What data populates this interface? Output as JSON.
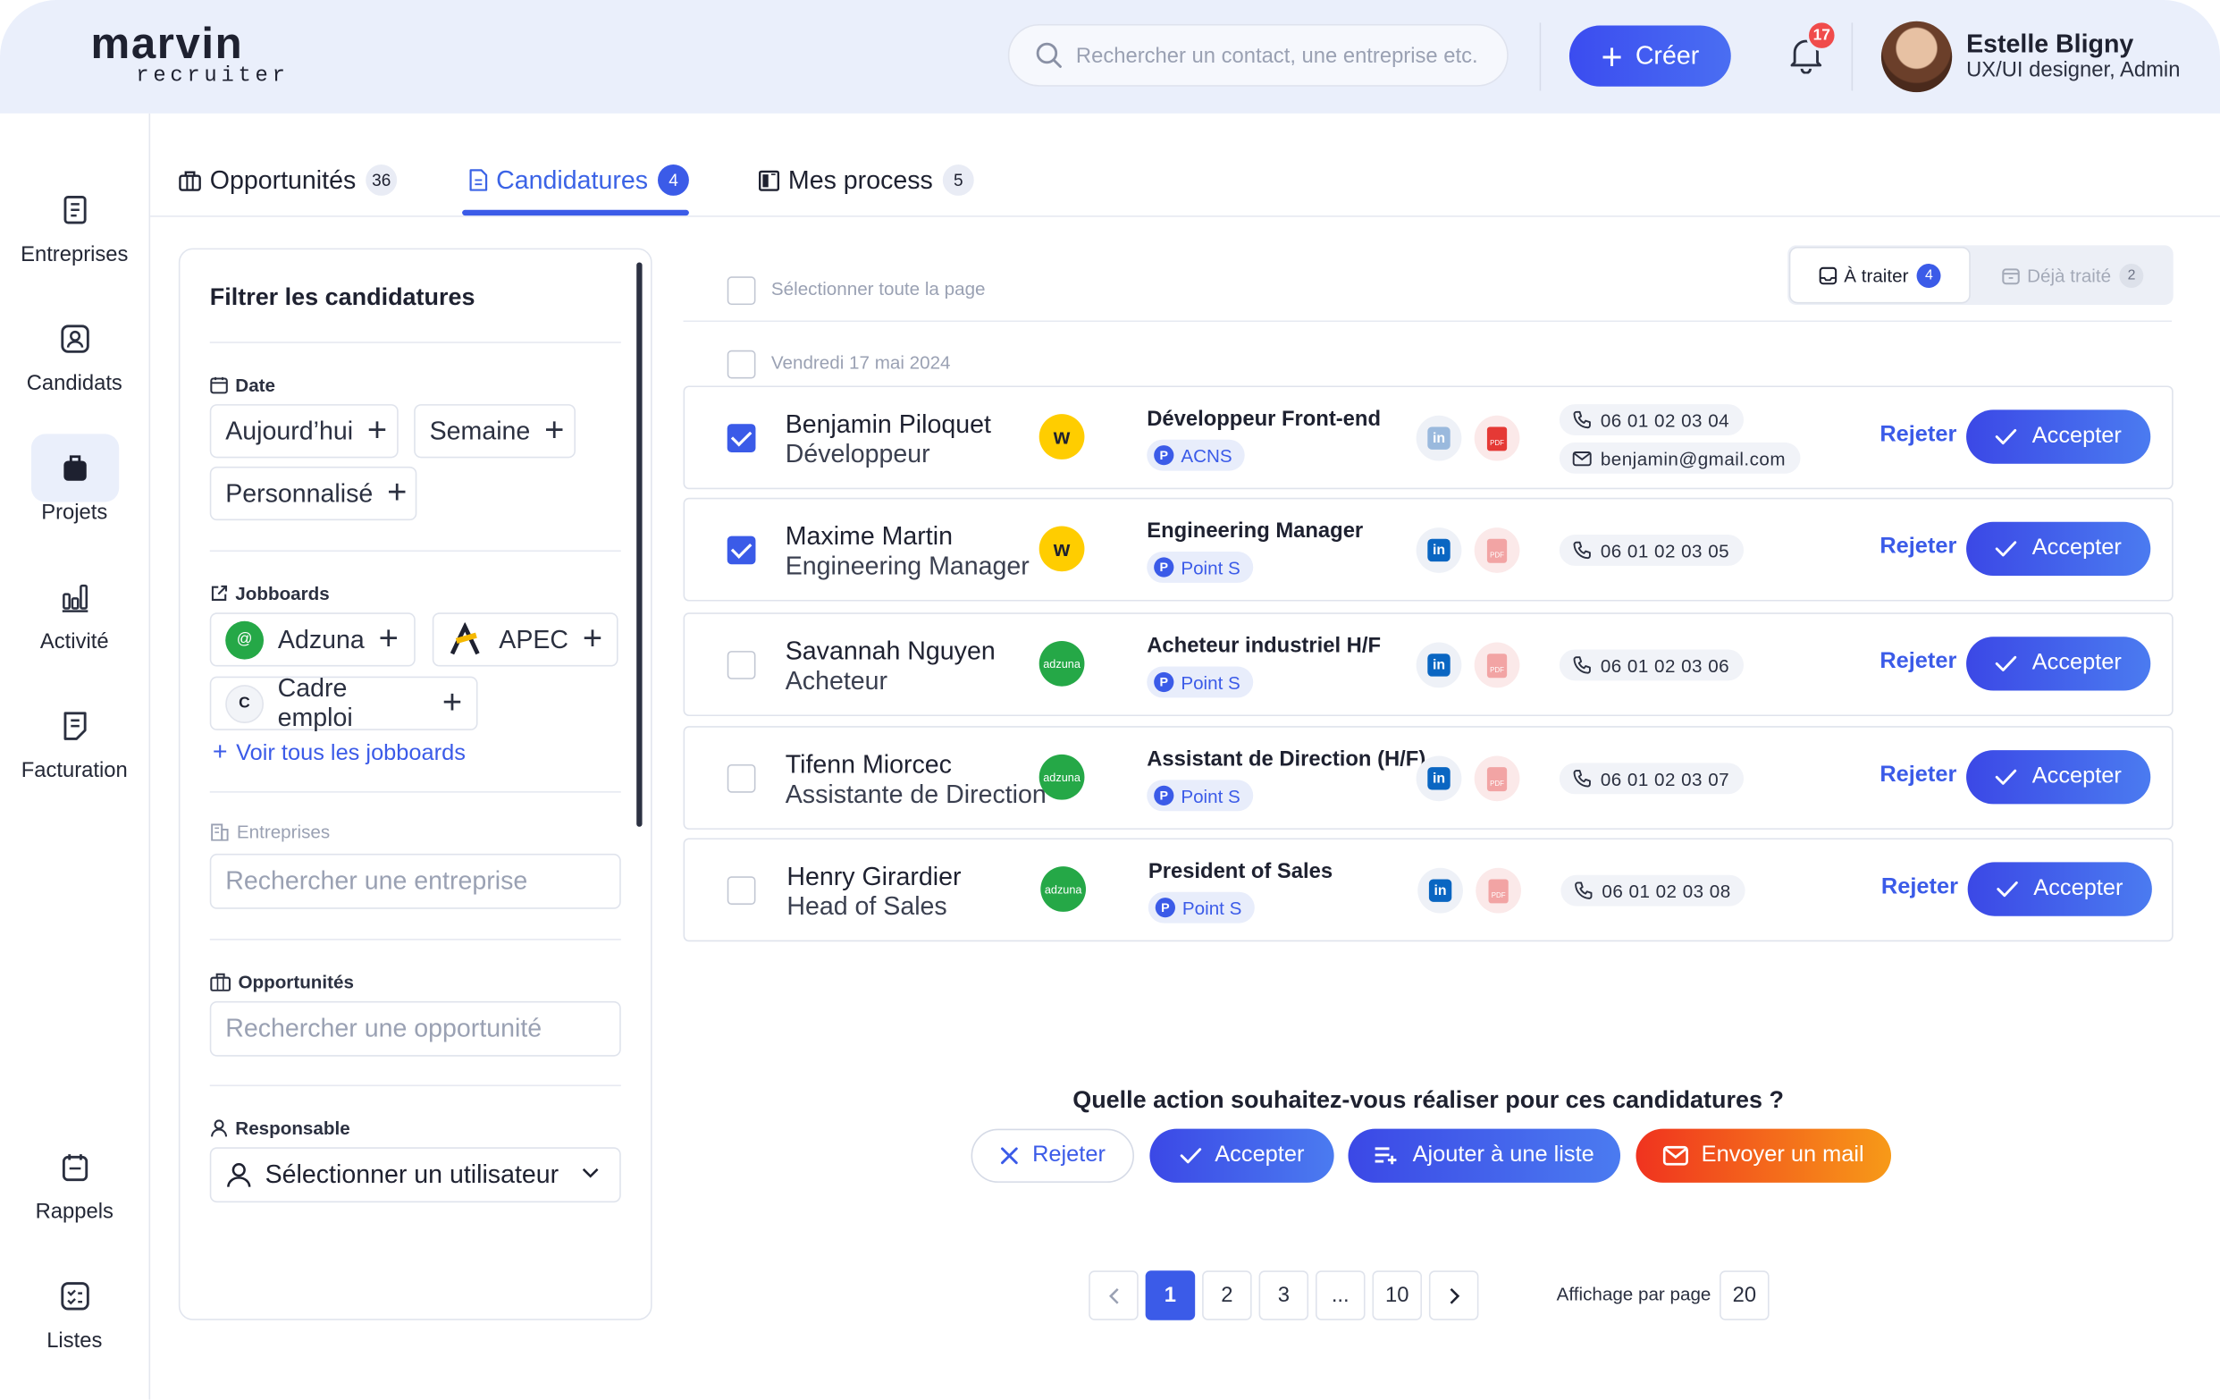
{
  "app": {
    "logo_main": "marvin",
    "logo_sub": "recruiter"
  },
  "header": {
    "search_placeholder": "Rechercher un contact, une entreprise etc.",
    "create_label": "Créer",
    "notifications_count": "17",
    "user_name": "Estelle Bligny",
    "user_role": "UX/UI designer, Admin"
  },
  "sidebar": {
    "items": [
      {
        "label": "Entreprises",
        "icon": "building-icon"
      },
      {
        "label": "Candidats",
        "icon": "user-badge-icon"
      },
      {
        "label": "Projets",
        "icon": "briefcase-icon"
      },
      {
        "label": "Activité",
        "icon": "bar-chart-icon"
      },
      {
        "label": "Facturation",
        "icon": "invoice-icon"
      },
      {
        "label": "Rappels",
        "icon": "calendar-icon"
      },
      {
        "label": "Listes",
        "icon": "checklist-icon"
      }
    ],
    "active": "Projets"
  },
  "tabs": [
    {
      "label": "Opportunités",
      "count": "36"
    },
    {
      "label": "Candidatures",
      "count": "4"
    },
    {
      "label": "Mes process",
      "count": "5"
    }
  ],
  "filters": {
    "title": "Filtrer les candidatures",
    "date_label": "Date",
    "date_chips": [
      "Aujourd’hui",
      "Semaine",
      "Personnalisé"
    ],
    "jobboards_label": "Jobboards",
    "jobboards": [
      "Adzuna",
      "APEC",
      "Cadre emploi"
    ],
    "see_all_jobboards": "Voir tous les jobboards",
    "companies_label": "Entreprises",
    "companies_placeholder": "Rechercher une entreprise",
    "opportunities_label": "Opportunités",
    "opportunities_placeholder": "Rechercher une opportunité",
    "owner_label": "Responsable",
    "owner_select": "Sélectionner un utilisateur"
  },
  "list": {
    "select_all": "Sélectionner toute la page",
    "date_group": "Vendredi 17 mai 2024",
    "toggle_todo": "À traiter",
    "toggle_todo_count": "4",
    "toggle_done": "Déjà traité",
    "toggle_done_count": "2",
    "reject_label": "Rejeter",
    "accept_label": "Accepter",
    "rows": [
      {
        "name": "Benjamin Piloquet",
        "title": "Développeur",
        "jobboard": "wttj",
        "job": "Développeur Front-end",
        "company": "ACNS",
        "phone": "06 01 02 03 04",
        "email": "benjamin@gmail.com",
        "checked": true
      },
      {
        "name": "Maxime Martin",
        "title": "Engineering Manager",
        "jobboard": "wttj",
        "job": "Engineering Manager",
        "company": "Point S",
        "phone": "06 01 02 03 05",
        "email": "",
        "checked": true
      },
      {
        "name": "Savannah Nguyen",
        "title": "Acheteur",
        "jobboard": "adzuna",
        "job": "Acheteur industriel H/F",
        "company": "Point S",
        "phone": "06 01 02 03 06",
        "email": "",
        "checked": false
      },
      {
        "name": "Tifenn Miorcec",
        "title": "Assistante de Direction",
        "jobboard": "adzuna",
        "job": "Assistant de Direction (H/F)",
        "company": "Point S",
        "phone": "06 01 02 03 07",
        "email": "",
        "checked": false
      },
      {
        "name": "Henry Girardier",
        "title": "Head of Sales",
        "jobboard": "adzuna",
        "job": "President of Sales",
        "company": "Point S",
        "phone": "06 01 02 03 08",
        "email": "",
        "checked": false
      }
    ]
  },
  "bulk": {
    "question": "Quelle action souhaitez-vous réaliser pour ces candidatures ?",
    "reject": "Rejeter",
    "accept": "Accepter",
    "add_list": "Ajouter à une liste",
    "send_mail": "Envoyer un mail"
  },
  "pagination": {
    "pages": [
      "1",
      "2",
      "3",
      "...",
      "10"
    ],
    "current": "1",
    "per_page_label": "Affichage par page",
    "per_page": "20"
  },
  "colors": {
    "primary": "#3b5be8",
    "header_bg": "#eaeffb",
    "mail_gradient_start": "#f0331f",
    "mail_gradient_end": "#f79a18"
  }
}
